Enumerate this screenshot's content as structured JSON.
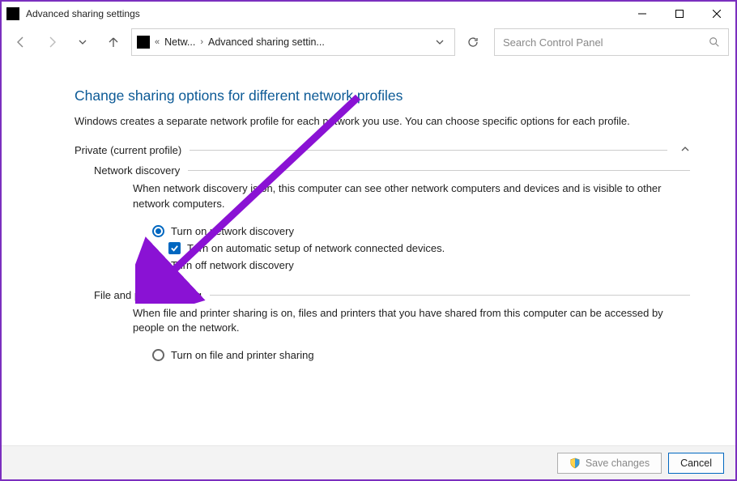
{
  "window": {
    "title": "Advanced sharing settings"
  },
  "breadcrumb": {
    "item1": "Netw...",
    "item2": "Advanced sharing settin..."
  },
  "search": {
    "placeholder": "Search Control Panel"
  },
  "page": {
    "title": "Change sharing options for different network profiles",
    "desc": "Windows creates a separate network profile for each network you use. You can choose specific options for each profile."
  },
  "groups": {
    "private": {
      "label": "Private (current profile)",
      "network_discovery": {
        "label": "Network discovery",
        "desc": "When network discovery is on, this computer can see other network computers and devices and is visible to other network computers.",
        "opt_on": "Turn on network discovery",
        "opt_auto": "Turn on automatic setup of network connected devices.",
        "opt_off": "Turn off network discovery"
      },
      "file_printer": {
        "label": "File and printer sharing",
        "desc": "When file and printer sharing is on, files and printers that you have shared from this computer can be accessed by people on the network.",
        "opt_on": "Turn on file and printer sharing"
      }
    }
  },
  "footer": {
    "save": "Save changes",
    "cancel": "Cancel"
  }
}
